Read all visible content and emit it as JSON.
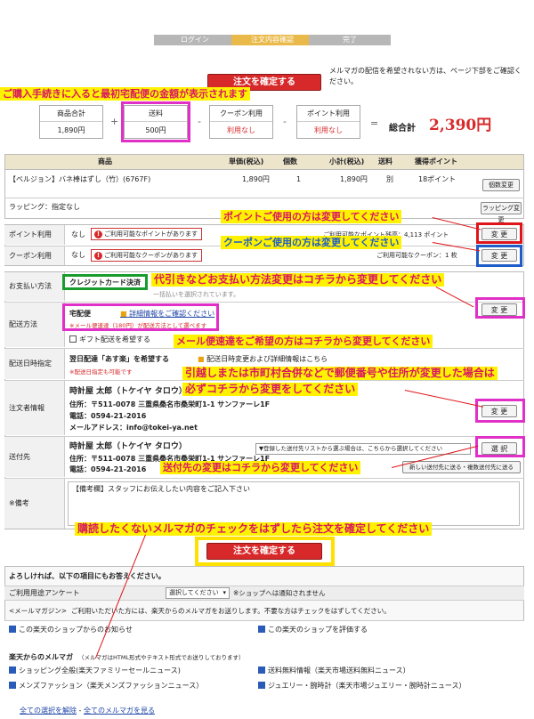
{
  "steps": [
    "ログイン",
    "注文内容確認",
    "完了"
  ],
  "confirm_label": "注文を確定する",
  "mailmag_note": "メルマガの配信を希望されない方は、ページ下部をご確認ください。",
  "annotations": {
    "first_delivery": "ご購入手続きに入ると最初宅配便の金額が表示されます",
    "points": "ポイントご使用の方は変更してください",
    "coupon": "クーポンご使用の方は変更してください",
    "payment": "代引きなどお支払い方法変更はコチラから変更してください",
    "mail_delivery": "メール便速達をご希望の方はコチラから変更してください",
    "address_line1": "引越しまたは市町村合併などで郵便番号や住所が変更した場合は",
    "address_line2": "必ずコチラから変更をしてください",
    "destination": "送付先の変更はコチラから変更してください",
    "mailmag_uncheck": "購読したくないメルマガのチェックをはずしたら注文を確定してください"
  },
  "summary": {
    "subtotal_label": "商品合計",
    "subtotal_value": "1,890円",
    "shipping_label": "送料",
    "shipping_value": "500円",
    "coupon_label": "クーポン利用",
    "coupon_value": "利用なし",
    "point_label": "ポイント利用",
    "point_value": "利用なし",
    "plus": "+",
    "minus": "-",
    "equals": "=",
    "total_label": "総合計",
    "total_value": "2,390円"
  },
  "table": {
    "headers": [
      "商品",
      "単価(税込)",
      "個数",
      "小計(税込)",
      "送料",
      "獲得ポイント"
    ],
    "row": {
      "name": "【ベルジョン】バネ棒はずし（竹）(6767F)",
      "price": "1,890円",
      "qty": "1",
      "subtotal": "1,890円",
      "shipping": "別",
      "points": "18ポイント"
    },
    "quantity_change": "個数変更",
    "wrapping_label": "ラッピング：指定なし",
    "wrapping_change": "ラッピング変更"
  },
  "point_row": {
    "label": "ポイント利用",
    "value": "なし",
    "warn": "ご利用可能なポイントがあります",
    "balance": "ご利用可能なポイント残高：4,113 ポイント"
  },
  "coupon_row": {
    "label": "クーポン利用",
    "value": "なし",
    "warn": "ご利用可能なクーポンがあります",
    "balance": "ご利用可能なクーポン：1 枚"
  },
  "change_label": "変 更",
  "select_label": "選 択",
  "payment_row": {
    "label": "お支払い方法",
    "method": "クレジットカード決済",
    "note": "一括払いを選択されています。"
  },
  "delivery_row": {
    "label": "配送方法",
    "method": "宅配便",
    "detail_link": "詳細情報をご確認ください",
    "note": "※メール便速達（180円）が配送方法として選べます",
    "gift": "ギフト配送を希望する"
  },
  "date_row": {
    "label": "配送日時指定",
    "service": "翌日配達「あす楽」を希望する",
    "detail": "配送日時変更および詳細情報はこちら",
    "note": "※配送日指定も可能です"
  },
  "orderer_row": {
    "label": "注文者情報",
    "name": "時計屋 太郎（トケイヤ タロウ）",
    "address": "住所：〒511-0078 三重県桑名市桑栄町1-1 サンファーレ1F",
    "phone": "電話：0594-21-2016",
    "email": "メールアドレス：info@tokei-ya.net"
  },
  "dest_row": {
    "label": "送付先",
    "name": "時計屋 太郎（トケイヤ タロウ）",
    "address": "住所：〒511-0078 三重県桑名市桑栄町1-1 サンファーレ1F",
    "phone": "電話：0594-21-2016",
    "select_placeholder": "▼登録した送付先リストから選ぶ場合は、こちらから選択してください",
    "new_dest": "新しい送付先に送る・複数送付先に送る"
  },
  "note_row": {
    "label": "※備考",
    "hint": "【備考欄】スタッフにお伝えしたい内容をご記入下さい"
  },
  "bottom": {
    "intro": "よろしければ、以下の項目にもお答えください。",
    "survey_label": "ご利用用途アンケート",
    "survey_select": "選択してください",
    "survey_note": "※ショップへは通知されません",
    "mailmag_title": "<メールマガジン>",
    "mailmag_desc": "ご利用いただいた方には、楽天からのメルマガをお送りします。不要な方はチェックをはずしてください。",
    "shop_news": "この楽天のショップからのお知らせ",
    "shop_review": "この楽天のショップを評価する",
    "rakuten_mag_title": "楽天からのメルマガ",
    "rakuten_mag_note": "（メルマガはHTML形式やテキスト形式でお送りしております）",
    "mags": [
      "ショッピング全般(楽天ファミリーセールニュース)",
      "送料無料情報（楽天市場送料無料ニュース）",
      "メンズファッション（楽天メンズファッションニュース）",
      "ジュエリー・腕時計（楽天市場ジュエリー・腕時計ニュース）"
    ],
    "uncheck_all": "全ての選択を解除",
    "sep": " - ",
    "all_mags": "全てのメルマガを見る"
  }
}
